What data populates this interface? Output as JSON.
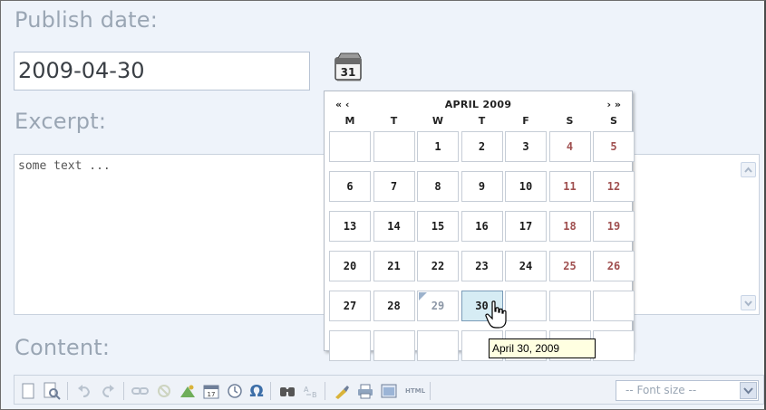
{
  "labels": {
    "publish_date": "Publish date:",
    "excerpt": "Excerpt:",
    "content": "Content:"
  },
  "publish_date_value": "2009-04-30",
  "calendar_button_text": "31",
  "excerpt_value": "some text ...",
  "calendar": {
    "prev_nav": "« ‹",
    "next_nav": "› »",
    "month_label": "APRIL 2009",
    "weekdays": [
      "M",
      "T",
      "W",
      "T",
      "F",
      "S",
      "S"
    ],
    "weeks": [
      [
        "",
        "",
        "1",
        "2",
        "3",
        "4",
        "5"
      ],
      [
        "6",
        "7",
        "8",
        "9",
        "10",
        "11",
        "12"
      ],
      [
        "13",
        "14",
        "15",
        "16",
        "17",
        "18",
        "19"
      ],
      [
        "20",
        "21",
        "22",
        "23",
        "24",
        "25",
        "26"
      ],
      [
        "27",
        "28",
        "29",
        "30",
        "",
        "",
        ""
      ],
      [
        "",
        "",
        "",
        "",
        "",
        "",
        ""
      ]
    ],
    "today": "29",
    "selected": "30"
  },
  "tooltip": "April 30, 2009",
  "toolbar": {
    "icons": [
      "new-document-icon",
      "preview-icon",
      "undo-icon",
      "redo-icon",
      "link-icon",
      "unlink-icon",
      "image-icon",
      "insert-date-icon",
      "insert-time-icon",
      "special-char-icon",
      "find-icon",
      "replace-icon",
      "cleanup-icon",
      "print-icon",
      "fullscreen-icon",
      "html-icon"
    ],
    "html_text": "HTML",
    "font_size_placeholder": "-- Font size --"
  },
  "colors": {
    "background": "#eef3fa",
    "label": "#9aa6b4",
    "weekend": "#a05050",
    "selected_day_bg": "#d6ecf4",
    "tooltip_bg": "#ffffe1"
  }
}
